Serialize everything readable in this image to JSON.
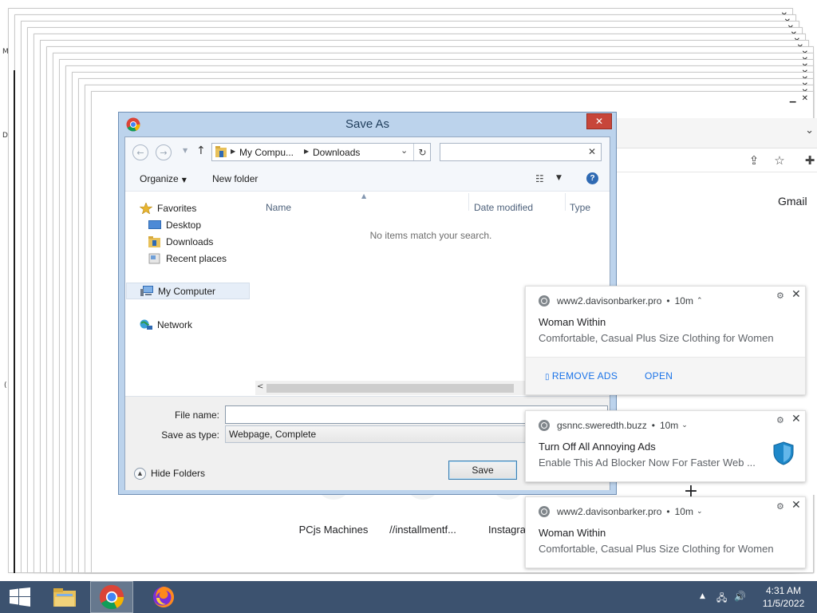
{
  "background_windows": {
    "control_glyphs": "▁ ✕"
  },
  "browser": {
    "gmail_label": "Gmail",
    "shortcuts": [
      {
        "label": "PCjs Machines"
      },
      {
        "label": "//installmentf..."
      },
      {
        "label": "Instagra"
      }
    ],
    "add_shortcut_icon": "plus-icon"
  },
  "dialog": {
    "title": "Save As",
    "close_glyph": "✕",
    "breadcrumb": [
      "My Compu...",
      "Downloads"
    ],
    "search_placeholder": "",
    "toolbar": {
      "organize_label": "Organize",
      "new_folder_label": "New folder",
      "help_label": "?"
    },
    "nav": {
      "favorites": "Favorites",
      "desktop": "Desktop",
      "downloads": "Downloads",
      "recent_places": "Recent places",
      "my_computer": "My Computer",
      "network": "Network"
    },
    "columns": {
      "name": "Name",
      "date_modified": "Date modified",
      "type": "Type"
    },
    "empty_message": "No items match your search.",
    "file_name_label": "File name:",
    "file_name_value": "",
    "save_as_type_label": "Save as type:",
    "save_as_type_value": "Webpage, Complete",
    "hide_folders_label": "Hide Folders",
    "save_label": "Save"
  },
  "notifications": [
    {
      "source": "www2.davisonbarker.pro",
      "time": "10m",
      "chevron": "⌃",
      "title": "Woman Within",
      "text": "Comfortable, Casual Plus Size Clothing for Women",
      "actions": {
        "remove_ads": "REMOVE ADS",
        "open": "OPEN"
      }
    },
    {
      "source": "gsnnc.sweredth.buzz",
      "time": "10m",
      "chevron": "⌄",
      "title": "Turn Off All Annoying Ads",
      "text": "Enable This Ad Blocker Now For Faster Web ..."
    },
    {
      "source": "www2.davisonbarker.pro",
      "time": "10m",
      "chevron": "⌄",
      "title": "Woman Within",
      "text": "Comfortable, Casual Plus Size Clothing for Women"
    }
  ],
  "taskbar": {
    "time": "4:31 AM",
    "date": "11/5/2022"
  },
  "colors": {
    "dialog_frame": "#bcd3ec",
    "close_red": "#c7463a",
    "taskbar": "#3c526f",
    "link_blue": "#1a73e8",
    "shield_blue": "#1e88c9"
  }
}
